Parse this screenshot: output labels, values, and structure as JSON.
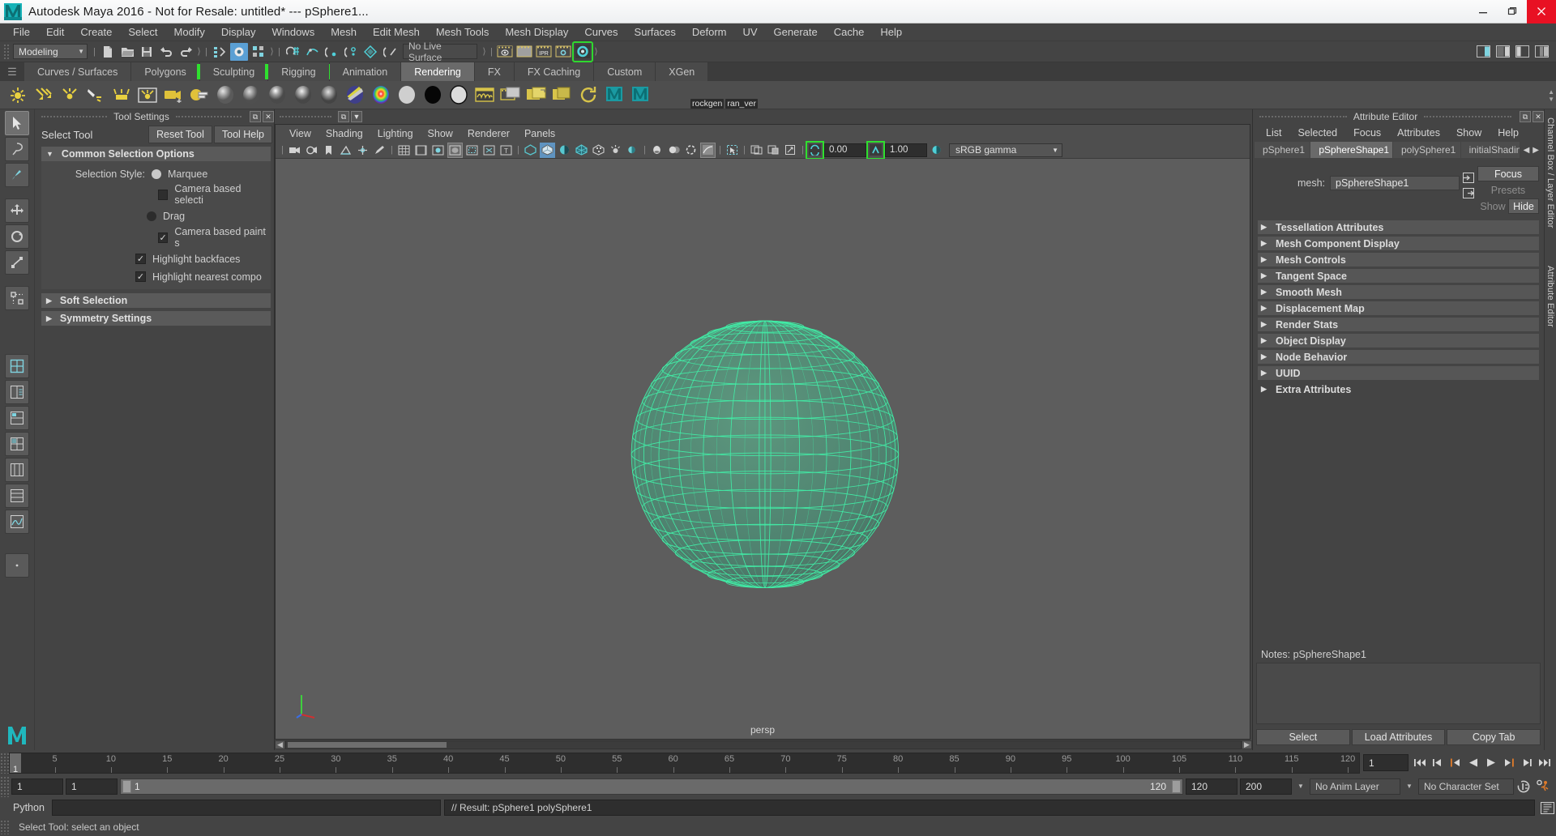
{
  "titlebar": {
    "title": "Autodesk Maya 2016 - Not for Resale: untitled*   ---   pSphere1...",
    "minimize": "—",
    "maximize": "❐",
    "close": "✕"
  },
  "menubar": {
    "items": [
      "File",
      "Edit",
      "Create",
      "Select",
      "Modify",
      "Display",
      "Windows",
      "Mesh",
      "Edit Mesh",
      "Mesh Tools",
      "Mesh Display",
      "Curves",
      "Surfaces",
      "Deform",
      "UV",
      "Generate",
      "Cache",
      "Help"
    ]
  },
  "statusline": {
    "mode": "Modeling",
    "live_surface": "No Live Surface"
  },
  "shelf": {
    "tabs": [
      {
        "label": "Curves / Surfaces",
        "active": false,
        "bracket": false
      },
      {
        "label": "Polygons",
        "active": false,
        "bracket": false
      },
      {
        "label": "Sculpting",
        "active": false,
        "bracket": true
      },
      {
        "label": "Rigging",
        "active": false,
        "bracket": true
      },
      {
        "label": "Animation",
        "active": false,
        "bracket": false
      },
      {
        "label": "Rendering",
        "active": true,
        "bracket": false
      },
      {
        "label": "FX",
        "active": false,
        "bracket": false
      },
      {
        "label": "FX Caching",
        "active": false,
        "bracket": false
      },
      {
        "label": "Custom",
        "active": false,
        "bracket": false
      },
      {
        "label": "XGen",
        "active": false,
        "bracket": false
      }
    ],
    "custom_icons": [
      {
        "label": "rockgen",
        "name": "rockgen-shelf-icon"
      },
      {
        "label": "ran_ver",
        "name": "ran-ver-shelf-icon"
      }
    ]
  },
  "tool_settings": {
    "panel_title": "Tool Settings",
    "tool_name": "Select Tool",
    "reset_button": "Reset Tool",
    "help_button": "Tool Help",
    "frames": [
      {
        "label": "Common Selection Options",
        "expanded": true
      },
      {
        "label": "Soft Selection",
        "expanded": false
      },
      {
        "label": "Symmetry Settings",
        "expanded": false
      }
    ],
    "selection_style_label": "Selection Style:",
    "options": [
      {
        "label": "Marquee",
        "type": "radio",
        "checked": true
      },
      {
        "label": "Camera based selecti",
        "type": "checkbox",
        "checked": false
      },
      {
        "label": "Drag",
        "type": "radio",
        "checked": false
      },
      {
        "label": "Camera based paint s",
        "type": "checkbox",
        "checked": true
      },
      {
        "label": "Highlight backfaces",
        "type": "checkbox",
        "checked": true
      },
      {
        "label": "Highlight nearest compo",
        "type": "checkbox",
        "checked": true
      }
    ]
  },
  "viewport": {
    "menus": [
      "View",
      "Shading",
      "Lighting",
      "Show",
      "Renderer",
      "Panels"
    ],
    "exposure": "0.00",
    "gamma_value": "1.00",
    "color_space": "sRGB gamma",
    "camera_label": "persp",
    "object_color": "#3ee8a0"
  },
  "attribute_editor": {
    "panel_title": "Attribute Editor",
    "menus": [
      "List",
      "Selected",
      "Focus",
      "Attributes",
      "Show",
      "Help"
    ],
    "tabs": [
      {
        "label": "pSphere1",
        "active": false
      },
      {
        "label": "pSphereShape1",
        "active": true
      },
      {
        "label": "polySphere1",
        "active": false
      },
      {
        "label": "initialShadingG",
        "active": false
      }
    ],
    "mesh_label": "mesh:",
    "mesh_value": "pSphereShape1",
    "focus_button": "Focus",
    "presets_button": "Presets",
    "show_button": "Show",
    "hide_button": "Hide",
    "sections": [
      "Tessellation Attributes",
      "Mesh Component Display",
      "Mesh Controls",
      "Tangent Space",
      "Smooth Mesh",
      "Displacement Map",
      "Render Stats",
      "Object Display",
      "Node Behavior",
      "UUID",
      "Extra Attributes"
    ],
    "notes_label": "Notes:  pSphereShape1",
    "buttons": [
      "Select",
      "Load Attributes",
      "Copy Tab"
    ]
  },
  "channel_box_strip": {
    "label": "Channel Box / Layer Editor"
  },
  "attribute_editor_strip": {
    "label": "Attribute Editor"
  },
  "timeline": {
    "start": 1,
    "end": 120,
    "current_frame": "1",
    "ticks": [
      5,
      10,
      15,
      20,
      25,
      30,
      35,
      40,
      45,
      50,
      55,
      60,
      65,
      70,
      75,
      80,
      85,
      90,
      95,
      100,
      105,
      110,
      115,
      120
    ],
    "cursor_label": "1",
    "range_start": "1",
    "range_start2": "1",
    "range_bar_left": "1",
    "range_bar_right": "120",
    "range_end": "120",
    "playback_end": "200",
    "anim_layer": "No Anim Layer",
    "character_set": "No Character Set"
  },
  "command_line": {
    "language": "Python",
    "input_value": "",
    "result": "// Result: pSphere1 polySphere1"
  },
  "help_line": {
    "text": "Select Tool: select an object"
  }
}
